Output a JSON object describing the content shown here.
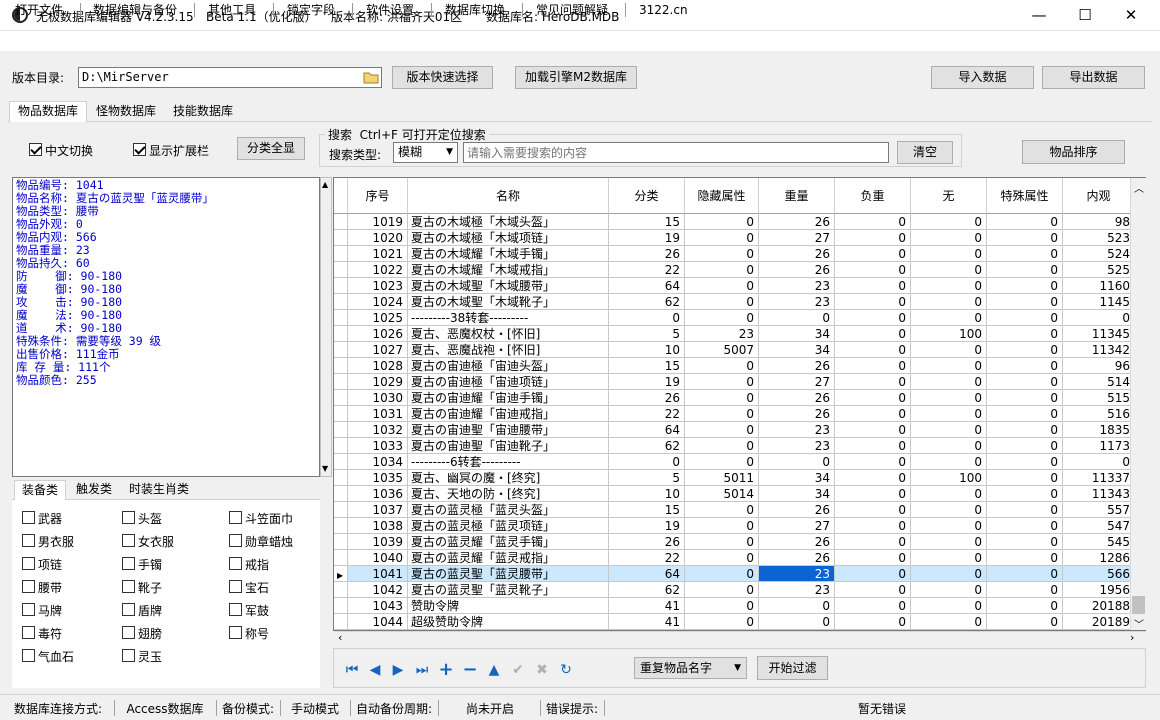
{
  "titlebar": {
    "app_name": "无极数据库编辑器 V4.2.3.15",
    "edition": "Beta 1.1（优化版）",
    "version_name": "版本名称: 洪福齐天01区",
    "database_name": "数据库名: HeroDB.MDB",
    "minimize": "—",
    "maximize": "☐",
    "close": "✕"
  },
  "menu": [
    "打开文件",
    "数据编辑与备份",
    "其他工具",
    "锁定字段",
    "软件设置",
    "数据库切换",
    "常见问题解疑",
    "3122.cn"
  ],
  "toolbar": {
    "dir_label": "版本目录:",
    "dir_value": "D:\\MirServer",
    "quick_select": "版本快速选择",
    "load_engine": "加载引擎M2数据库",
    "import": "导入数据",
    "export": "导出数据"
  },
  "main_tabs": [
    "物品数据库",
    "怪物数据库",
    "技能数据库"
  ],
  "options": {
    "chinese_switch": "中文切换",
    "chinese_switch_checked": true,
    "show_expand": "显示扩展栏",
    "show_expand_checked": true,
    "show_all": "分类全显",
    "search_group_title": "搜索  Ctrl+F 可打开定位搜索",
    "search_type_label": "搜索类型:",
    "search_type_value": "模糊",
    "search_placeholder": "请输入需要搜索的内容",
    "clear": "清空",
    "sort": "物品排序"
  },
  "item_info": [
    "物品编号: 1041",
    "物品名称: 夏古の蓝灵聖「蓝灵腰带」",
    "物品类型: 腰带",
    "物品外观: 0",
    "物品内观: 566",
    "物品重量: 23",
    "物品持久: 60",
    "防    御: 90-180",
    "魔    御: 90-180",
    "攻    击: 90-180",
    "魔    法: 90-180",
    "道    术: 90-180",
    "特殊条件: 需要等级 39 级",
    "出售价格: 111金币",
    "库 存 量: 111个",
    "物品颜色: 255"
  ],
  "category_tabs": [
    "装备类",
    "触发类",
    "时装生肖类"
  ],
  "categories": [
    [
      "武器",
      "头盔",
      "斗笠面巾"
    ],
    [
      "男衣服",
      "女衣服",
      "勋章蜡烛"
    ],
    [
      "项链",
      "手镯",
      "戒指"
    ],
    [
      "腰带",
      "靴子",
      "宝石"
    ],
    [
      "马牌",
      "盾牌",
      "军鼓"
    ],
    [
      "毒符",
      "翅膀",
      "称号"
    ],
    [
      "气血石",
      "灵玉",
      ""
    ]
  ],
  "grid": {
    "columns": [
      "序号",
      "名称",
      "分类",
      "隐藏属性",
      "重量",
      "负重",
      "无",
      "特殊属性",
      "内观"
    ],
    "selected_index": 22,
    "rows": [
      [
        "1019",
        "夏古の木域極「木域头盔」",
        "15",
        "0",
        "26",
        "0",
        "0",
        "0",
        "98"
      ],
      [
        "1020",
        "夏古の木域極「木域项链」",
        "19",
        "0",
        "27",
        "0",
        "0",
        "0",
        "523"
      ],
      [
        "1021",
        "夏古の木域耀「木域手镯」",
        "26",
        "0",
        "26",
        "0",
        "0",
        "0",
        "524"
      ],
      [
        "1022",
        "夏古の木域耀「木域戒指」",
        "22",
        "0",
        "26",
        "0",
        "0",
        "0",
        "525"
      ],
      [
        "1023",
        "夏古の木域聖「木域腰带」",
        "64",
        "0",
        "23",
        "0",
        "0",
        "0",
        "1160"
      ],
      [
        "1024",
        "夏古の木域聖「木域靴子」",
        "62",
        "0",
        "23",
        "0",
        "0",
        "0",
        "1145"
      ],
      [
        "1025",
        "---------38转套---------",
        "0",
        "0",
        "0",
        "0",
        "0",
        "0",
        "0"
      ],
      [
        "1026",
        "夏古、恶魔权杖・[怀旧]",
        "5",
        "23",
        "34",
        "0",
        "100",
        "0",
        "11345"
      ],
      [
        "1027",
        "夏古、恶魔战袍・[怀旧]",
        "10",
        "5007",
        "34",
        "0",
        "0",
        "0",
        "11342"
      ],
      [
        "1028",
        "夏古の宙迪極「宙迪头盔」",
        "15",
        "0",
        "26",
        "0",
        "0",
        "0",
        "96"
      ],
      [
        "1029",
        "夏古の宙迪極「宙迪项链」",
        "19",
        "0",
        "27",
        "0",
        "0",
        "0",
        "514"
      ],
      [
        "1030",
        "夏古の宙迪耀「宙迪手镯」",
        "26",
        "0",
        "26",
        "0",
        "0",
        "0",
        "515"
      ],
      [
        "1031",
        "夏古の宙迪耀「宙迪戒指」",
        "22",
        "0",
        "26",
        "0",
        "0",
        "0",
        "516"
      ],
      [
        "1032",
        "夏古の宙迪聖「宙迪腰带」",
        "64",
        "0",
        "23",
        "0",
        "0",
        "0",
        "1835"
      ],
      [
        "1033",
        "夏古の宙迪聖「宙迪靴子」",
        "62",
        "0",
        "23",
        "0",
        "0",
        "0",
        "1173"
      ],
      [
        "1034",
        "---------6转套---------",
        "0",
        "0",
        "0",
        "0",
        "0",
        "0",
        "0"
      ],
      [
        "1035",
        "夏古、幽冥の魔・[终究]",
        "5",
        "5011",
        "34",
        "0",
        "100",
        "0",
        "11337"
      ],
      [
        "1036",
        "夏古、天地の防・[终究]",
        "10",
        "5014",
        "34",
        "0",
        "0",
        "0",
        "11343"
      ],
      [
        "1037",
        "夏古の蓝灵極「蓝灵头盔」",
        "15",
        "0",
        "26",
        "0",
        "0",
        "0",
        "557"
      ],
      [
        "1038",
        "夏古の蓝灵極「蓝灵项链」",
        "19",
        "0",
        "27",
        "0",
        "0",
        "0",
        "547"
      ],
      [
        "1039",
        "夏古の蓝灵耀「蓝灵手镯」",
        "26",
        "0",
        "26",
        "0",
        "0",
        "0",
        "545"
      ],
      [
        "1040",
        "夏古の蓝灵耀「蓝灵戒指」",
        "22",
        "0",
        "26",
        "0",
        "0",
        "0",
        "1286"
      ],
      [
        "1041",
        "夏古の蓝灵聖「蓝灵腰带」",
        "64",
        "0",
        "23",
        "0",
        "0",
        "0",
        "566"
      ],
      [
        "1042",
        "夏古の蓝灵聖「蓝灵靴子」",
        "62",
        "0",
        "23",
        "0",
        "0",
        "0",
        "1956"
      ],
      [
        "1043",
        "赞助令牌",
        "41",
        "0",
        "0",
        "0",
        "0",
        "0",
        "20188"
      ],
      [
        "1044",
        "超级赞助令牌",
        "41",
        "0",
        "0",
        "0",
        "0",
        "0",
        "20189"
      ]
    ]
  },
  "bottom": {
    "nav_icons": [
      "first-icon",
      "prev-icon",
      "next-icon",
      "last-icon",
      "add-icon",
      "delete-icon",
      "up-icon",
      "confirm-icon",
      "cancel-icon",
      "refresh-icon"
    ],
    "filter_select": "重复物品名字",
    "filter_button": "开始过滤"
  },
  "status": {
    "conn_label": "数据库连接方式:",
    "conn_value": "Access数据库",
    "backup_label": "备份模式:",
    "backup_value": "手动模式",
    "auto_label": "自动备份周期:",
    "auto_value": "尚未开启",
    "error_label": "错误提示:",
    "error_value": "暂无错误"
  }
}
